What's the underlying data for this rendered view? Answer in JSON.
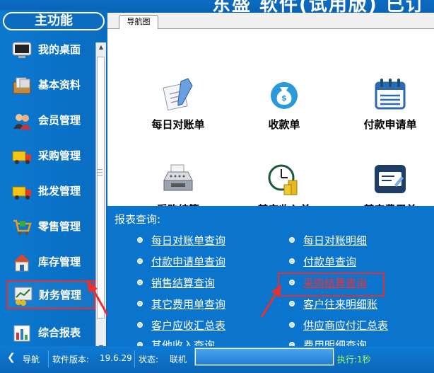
{
  "window": {
    "title": "东盛 软件(试用版) 已订"
  },
  "sidebar": {
    "header": "主功能",
    "items": [
      {
        "label": "我的桌面",
        "icon": "monitor-icon"
      },
      {
        "label": "基本资料",
        "icon": "documents-icon"
      },
      {
        "label": "会员管理",
        "icon": "users-icon"
      },
      {
        "label": "采购管理",
        "icon": "truck-icon"
      },
      {
        "label": "批发管理",
        "icon": "truck-icon"
      },
      {
        "label": "零售管理",
        "icon": "cart-icon"
      },
      {
        "label": "库存管理",
        "icon": "house-icon"
      },
      {
        "label": "财务管理",
        "icon": "finance-icon"
      },
      {
        "label": "综合报表",
        "icon": "bar-chart-icon"
      }
    ],
    "active_index": 7
  },
  "tabs": [
    {
      "label": "导航图"
    }
  ],
  "nav_items": [
    {
      "label": "每日对账单",
      "icon": "reconcile-icon"
    },
    {
      "label": "收款单",
      "icon": "money-bag-icon"
    },
    {
      "label": "付款申请单",
      "icon": "calendar-icon"
    },
    {
      "label": "采购结算",
      "icon": "cash-register-icon"
    },
    {
      "label": "其它收入单",
      "icon": "clock-coins-icon"
    },
    {
      "label": "其它费用单",
      "icon": "card-icon"
    }
  ],
  "reports": {
    "title": "报表查询:",
    "links": [
      "每日对账单查询",
      "每日对账明细",
      "付款申请单查询",
      "付款单查询",
      "销售结算查询",
      "采购结算查询",
      "其它费用单查询",
      "客户往来明细账",
      "客户应收汇总表",
      "供应商应付汇总表",
      "其他收入查询",
      "费用明细查询"
    ],
    "highlight_index": 5
  },
  "status": {
    "nav_label": "导航",
    "version_label": "软件版本:",
    "version": "19.6.29",
    "state_label": "状态:",
    "state": "联机",
    "progress": 1.0,
    "exec_label": "执行:1秒"
  },
  "colors": {
    "accent": "#0b74cc",
    "highlight": "#e03030"
  }
}
